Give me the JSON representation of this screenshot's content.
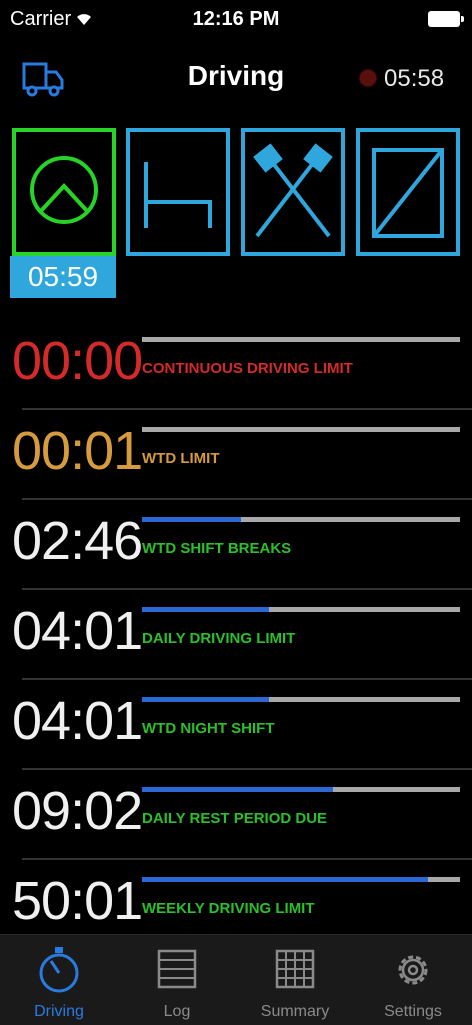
{
  "status_bar": {
    "carrier": "Carrier",
    "time": "12:16 PM"
  },
  "nav": {
    "title": "Driving",
    "record_time": "05:58",
    "icon": "truck-icon"
  },
  "activities": [
    {
      "name": "driving",
      "icon": "steering-wheel-icon",
      "active": true
    },
    {
      "name": "rest",
      "icon": "bed-icon",
      "active": false
    },
    {
      "name": "work",
      "icon": "crossed-hammers-icon",
      "active": false
    },
    {
      "name": "availability",
      "icon": "availability-icon",
      "active": false
    }
  ],
  "active_timer": "05:59",
  "limits": [
    {
      "value": "00:00",
      "label": "CONTINUOUS DRIVING LIMIT",
      "progress": 0.0,
      "value_color": "#d42a2a",
      "label_color": "#d42a2a"
    },
    {
      "value": "00:01",
      "label": "WTD LIMIT",
      "progress": 0.0,
      "value_color": "#d69b3c",
      "label_color": "#d69b3c"
    },
    {
      "value": "02:46",
      "label": "WTD SHIFT BREAKS",
      "progress": 0.31,
      "value_color": "#f0f0f0",
      "label_color": "#2bc02b"
    },
    {
      "value": "04:01",
      "label": "DAILY DRIVING LIMIT",
      "progress": 0.4,
      "value_color": "#f0f0f0",
      "label_color": "#2bc02b"
    },
    {
      "value": "04:01",
      "label": "WTD NIGHT SHIFT",
      "progress": 0.4,
      "value_color": "#f0f0f0",
      "label_color": "#2bc02b"
    },
    {
      "value": "09:02",
      "label": "DAILY REST PERIOD DUE",
      "progress": 0.6,
      "value_color": "#f0f0f0",
      "label_color": "#2bc02b"
    },
    {
      "value": "50:01",
      "label": "WEEKLY DRIVING LIMIT",
      "progress": 0.9,
      "value_color": "#f0f0f0",
      "label_color": "#2bc02b"
    }
  ],
  "tabs": [
    {
      "label": "Driving",
      "icon": "stopwatch-icon",
      "active": true
    },
    {
      "label": "Log",
      "icon": "list-icon",
      "active": false
    },
    {
      "label": "Summary",
      "icon": "grid-icon",
      "active": false
    },
    {
      "label": "Settings",
      "icon": "gear-icon",
      "active": false
    }
  ]
}
